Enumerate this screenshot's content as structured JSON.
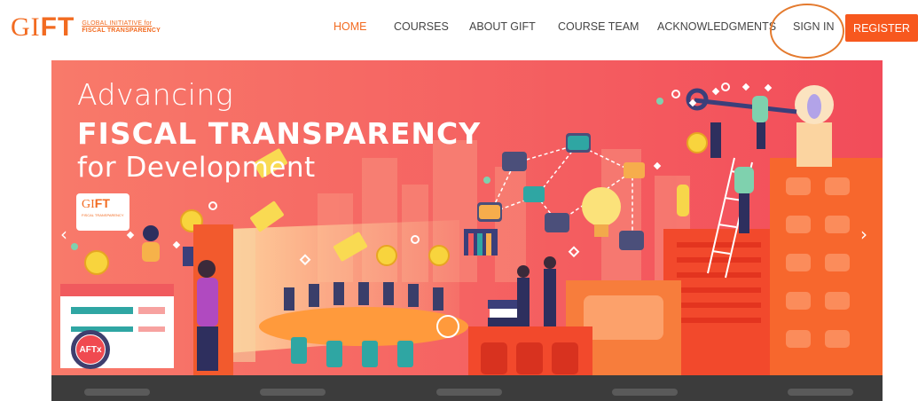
{
  "header": {
    "logo": {
      "big_g": "G",
      "big_i": "I",
      "big_ft": "FT",
      "small_line1": "GLOBAL INITIATIVE for",
      "small_line2": "FISCAL TRANSPARENCY"
    },
    "nav": [
      {
        "label": "HOME",
        "active": true
      },
      {
        "label": "COURSES"
      },
      {
        "label": "ABOUT GIFT"
      },
      {
        "label": "COURSE TEAM"
      },
      {
        "label": "ACKNOWLEDGMENTS"
      },
      {
        "label": "SIGN IN"
      }
    ],
    "register_label": "REGISTER"
  },
  "hero": {
    "title_line1": "Advancing",
    "title_line2": "FISCAL TRANSPARENCY",
    "title_line3": "for Development",
    "badge": {
      "big_g": "GI",
      "big_ft": "FT",
      "small": "FISCAL TRANSPARENCY"
    },
    "aftx_label": "AFTx",
    "prev_arrow": "‹",
    "next_arrow": "›"
  },
  "colors": {
    "accent": "#f26b21",
    "register_bg": "#f7581e",
    "hero_gradient_start": "#f87a6a",
    "hero_gradient_end": "#f24c5a",
    "signin_ring": "#e47a2e"
  },
  "icons": {
    "prev": "chevron-left-icon",
    "next": "chevron-right-icon"
  }
}
